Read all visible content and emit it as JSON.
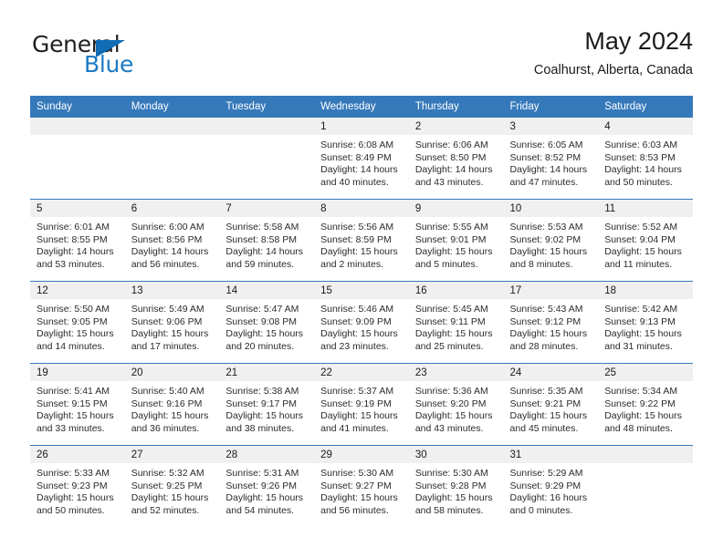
{
  "logo": {
    "word_top": "General",
    "word_bottom": "Blue",
    "triangle_color": "#0f6cb5",
    "blue_color": "#1b7ac4"
  },
  "header": {
    "title": "May 2024",
    "subtitle": "Coalhurst, Alberta, Canada"
  },
  "theme": {
    "header_bg": "#3679bb",
    "daynum_bg": "#f0f0f0",
    "text": "#1a1a1a"
  },
  "calendar": {
    "weekday_headers": [
      "Sunday",
      "Monday",
      "Tuesday",
      "Wednesday",
      "Thursday",
      "Friday",
      "Saturday"
    ],
    "labels": {
      "sunrise": "Sunrise:",
      "sunset": "Sunset:",
      "daylight": "Daylight:"
    },
    "weeks": [
      [
        {
          "day": ""
        },
        {
          "day": ""
        },
        {
          "day": ""
        },
        {
          "day": "1",
          "sunrise": "Sunrise: 6:08 AM",
          "sunset": "Sunset: 8:49 PM",
          "daylight": "Daylight: 14 hours and 40 minutes."
        },
        {
          "day": "2",
          "sunrise": "Sunrise: 6:06 AM",
          "sunset": "Sunset: 8:50 PM",
          "daylight": "Daylight: 14 hours and 43 minutes."
        },
        {
          "day": "3",
          "sunrise": "Sunrise: 6:05 AM",
          "sunset": "Sunset: 8:52 PM",
          "daylight": "Daylight: 14 hours and 47 minutes."
        },
        {
          "day": "4",
          "sunrise": "Sunrise: 6:03 AM",
          "sunset": "Sunset: 8:53 PM",
          "daylight": "Daylight: 14 hours and 50 minutes."
        }
      ],
      [
        {
          "day": "5",
          "sunrise": "Sunrise: 6:01 AM",
          "sunset": "Sunset: 8:55 PM",
          "daylight": "Daylight: 14 hours and 53 minutes."
        },
        {
          "day": "6",
          "sunrise": "Sunrise: 6:00 AM",
          "sunset": "Sunset: 8:56 PM",
          "daylight": "Daylight: 14 hours and 56 minutes."
        },
        {
          "day": "7",
          "sunrise": "Sunrise: 5:58 AM",
          "sunset": "Sunset: 8:58 PM",
          "daylight": "Daylight: 14 hours and 59 minutes."
        },
        {
          "day": "8",
          "sunrise": "Sunrise: 5:56 AM",
          "sunset": "Sunset: 8:59 PM",
          "daylight": "Daylight: 15 hours and 2 minutes."
        },
        {
          "day": "9",
          "sunrise": "Sunrise: 5:55 AM",
          "sunset": "Sunset: 9:01 PM",
          "daylight": "Daylight: 15 hours and 5 minutes."
        },
        {
          "day": "10",
          "sunrise": "Sunrise: 5:53 AM",
          "sunset": "Sunset: 9:02 PM",
          "daylight": "Daylight: 15 hours and 8 minutes."
        },
        {
          "day": "11",
          "sunrise": "Sunrise: 5:52 AM",
          "sunset": "Sunset: 9:04 PM",
          "daylight": "Daylight: 15 hours and 11 minutes."
        }
      ],
      [
        {
          "day": "12",
          "sunrise": "Sunrise: 5:50 AM",
          "sunset": "Sunset: 9:05 PM",
          "daylight": "Daylight: 15 hours and 14 minutes."
        },
        {
          "day": "13",
          "sunrise": "Sunrise: 5:49 AM",
          "sunset": "Sunset: 9:06 PM",
          "daylight": "Daylight: 15 hours and 17 minutes."
        },
        {
          "day": "14",
          "sunrise": "Sunrise: 5:47 AM",
          "sunset": "Sunset: 9:08 PM",
          "daylight": "Daylight: 15 hours and 20 minutes."
        },
        {
          "day": "15",
          "sunrise": "Sunrise: 5:46 AM",
          "sunset": "Sunset: 9:09 PM",
          "daylight": "Daylight: 15 hours and 23 minutes."
        },
        {
          "day": "16",
          "sunrise": "Sunrise: 5:45 AM",
          "sunset": "Sunset: 9:11 PM",
          "daylight": "Daylight: 15 hours and 25 minutes."
        },
        {
          "day": "17",
          "sunrise": "Sunrise: 5:43 AM",
          "sunset": "Sunset: 9:12 PM",
          "daylight": "Daylight: 15 hours and 28 minutes."
        },
        {
          "day": "18",
          "sunrise": "Sunrise: 5:42 AM",
          "sunset": "Sunset: 9:13 PM",
          "daylight": "Daylight: 15 hours and 31 minutes."
        }
      ],
      [
        {
          "day": "19",
          "sunrise": "Sunrise: 5:41 AM",
          "sunset": "Sunset: 9:15 PM",
          "daylight": "Daylight: 15 hours and 33 minutes."
        },
        {
          "day": "20",
          "sunrise": "Sunrise: 5:40 AM",
          "sunset": "Sunset: 9:16 PM",
          "daylight": "Daylight: 15 hours and 36 minutes."
        },
        {
          "day": "21",
          "sunrise": "Sunrise: 5:38 AM",
          "sunset": "Sunset: 9:17 PM",
          "daylight": "Daylight: 15 hours and 38 minutes."
        },
        {
          "day": "22",
          "sunrise": "Sunrise: 5:37 AM",
          "sunset": "Sunset: 9:19 PM",
          "daylight": "Daylight: 15 hours and 41 minutes."
        },
        {
          "day": "23",
          "sunrise": "Sunrise: 5:36 AM",
          "sunset": "Sunset: 9:20 PM",
          "daylight": "Daylight: 15 hours and 43 minutes."
        },
        {
          "day": "24",
          "sunrise": "Sunrise: 5:35 AM",
          "sunset": "Sunset: 9:21 PM",
          "daylight": "Daylight: 15 hours and 45 minutes."
        },
        {
          "day": "25",
          "sunrise": "Sunrise: 5:34 AM",
          "sunset": "Sunset: 9:22 PM",
          "daylight": "Daylight: 15 hours and 48 minutes."
        }
      ],
      [
        {
          "day": "26",
          "sunrise": "Sunrise: 5:33 AM",
          "sunset": "Sunset: 9:23 PM",
          "daylight": "Daylight: 15 hours and 50 minutes."
        },
        {
          "day": "27",
          "sunrise": "Sunrise: 5:32 AM",
          "sunset": "Sunset: 9:25 PM",
          "daylight": "Daylight: 15 hours and 52 minutes."
        },
        {
          "day": "28",
          "sunrise": "Sunrise: 5:31 AM",
          "sunset": "Sunset: 9:26 PM",
          "daylight": "Daylight: 15 hours and 54 minutes."
        },
        {
          "day": "29",
          "sunrise": "Sunrise: 5:30 AM",
          "sunset": "Sunset: 9:27 PM",
          "daylight": "Daylight: 15 hours and 56 minutes."
        },
        {
          "day": "30",
          "sunrise": "Sunrise: 5:30 AM",
          "sunset": "Sunset: 9:28 PM",
          "daylight": "Daylight: 15 hours and 58 minutes."
        },
        {
          "day": "31",
          "sunrise": "Sunrise: 5:29 AM",
          "sunset": "Sunset: 9:29 PM",
          "daylight": "Daylight: 16 hours and 0 minutes."
        },
        {
          "day": ""
        }
      ]
    ]
  }
}
